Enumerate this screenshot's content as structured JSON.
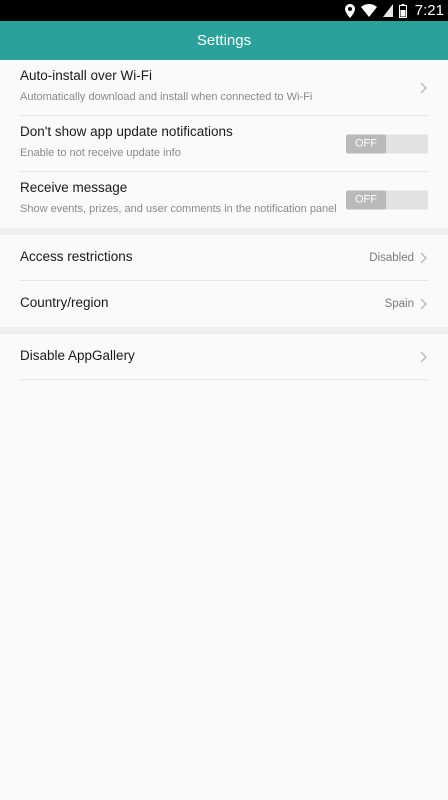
{
  "status_bar": {
    "time": "7:21"
  },
  "title_bar": {
    "title": "Settings"
  },
  "groups": [
    {
      "items": [
        {
          "title": "Auto-install over Wi-Fi",
          "subtitle": "Automatically download and install when connected to Wi-Fi",
          "control": "chevron-right-icon"
        },
        {
          "title": "Don't show app update notifications",
          "subtitle": "Enable to not receive update info",
          "toggle": "OFF"
        },
        {
          "title": "Receive message",
          "subtitle": "Show events, prizes, and user comments in the notification panel",
          "toggle": "OFF"
        }
      ]
    },
    {
      "items": [
        {
          "title": "Access restrictions",
          "value": "Disabled",
          "control": "chevron-right-icon"
        },
        {
          "title": "Country/region",
          "value": "Spain",
          "control": "chevron-right-icon"
        }
      ]
    },
    {
      "items": [
        {
          "title": "Disable AppGallery",
          "control": "chevron-right-icon"
        }
      ]
    }
  ],
  "colors": {
    "accent": "#2aa19b",
    "status_bar": "#000000",
    "background": "#f9f9f9"
  }
}
